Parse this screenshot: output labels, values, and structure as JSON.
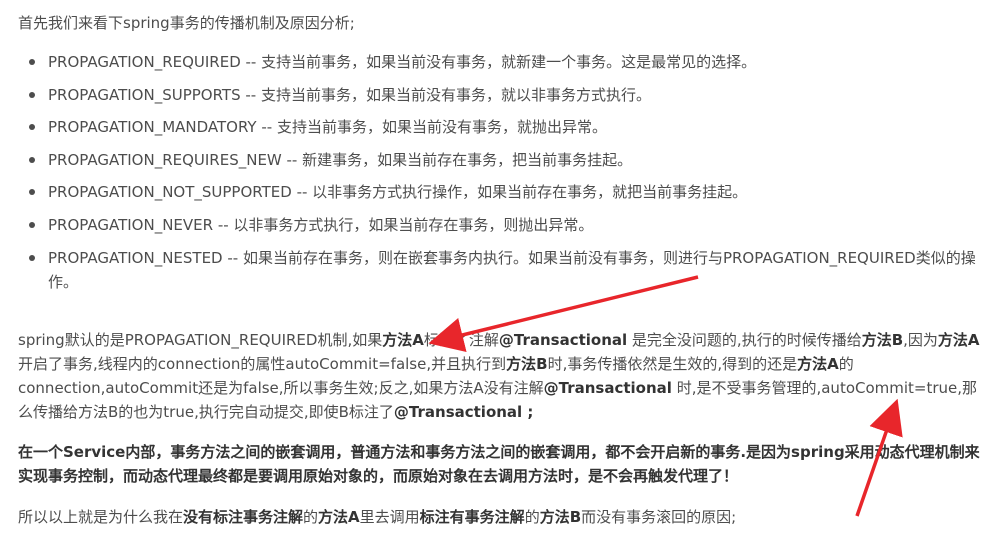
{
  "intro": "首先我们来看下spring事务的传播机制及原因分析;",
  "propagation_items": [
    "PROPAGATION_REQUIRED -- 支持当前事务，如果当前没有事务，就新建一个事务。这是最常见的选择。",
    "PROPAGATION_SUPPORTS -- 支持当前事务，如果当前没有事务，就以非事务方式执行。",
    "PROPAGATION_MANDATORY -- 支持当前事务，如果当前没有事务，就抛出异常。",
    "PROPAGATION_REQUIRES_NEW -- 新建事务，如果当前存在事务，把当前事务挂起。",
    "PROPAGATION_NOT_SUPPORTED -- 以非事务方式执行操作，如果当前存在事务，就把当前事务挂起。",
    "PROPAGATION_NEVER -- 以非事务方式执行，如果当前存在事务，则抛出异常。",
    "PROPAGATION_NESTED -- 如果当前存在事务，则在嵌套事务内执行。如果当前没有事务，则进行与PROPAGATION_REQUIRED类似的操作。"
  ],
  "para1": {
    "t1": "spring默认的是PROPAGATION_REQUIRED机制,如果",
    "b1": "方法A",
    "t2": "标注了注解",
    "b2": "@Transactional",
    "t3": " 是完全没问题的,执行的时候传播给",
    "b3": "方法B",
    "t4": ",因为",
    "b4": "方法A",
    "t5": "开启了事务,线程内的connection的属性autoCommit=false,并且执行到",
    "b5": "方法B",
    "t6": "时,事务传播依然是生效的,得到的还是",
    "b6": "方法A",
    "t7": "的connection,autoCommit还是为false,所以事务生效;反之,如果方法A没有注解",
    "b7": "@Transactional",
    "t8": " 时,是不受事务管理的,autoCommit=true,那么传播给方法B的也为true,执行完自动提交,即使B标注了",
    "b8": "@Transactional ;"
  },
  "para2": "在一个Service内部，事务方法之间的嵌套调用，普通方法和事务方法之间的嵌套调用，都不会开启新的事务.是因为spring采用动态代理机制来实现事务控制，而动态代理最终都是要调用原始对象的，而原始对象在去调用方法时，是不会再触发代理了！",
  "para3": {
    "t1": "所以以上就是为什么我在",
    "b1": "没有标注事务注解",
    "t2": "的",
    "b2": "方法A",
    "t3": "里去调用",
    "b3": "标注有事务注解",
    "t4": "的",
    "b4": "方法B",
    "t5": "而没有事务滚回的原因;"
  },
  "annotation_color": "#e8262b"
}
